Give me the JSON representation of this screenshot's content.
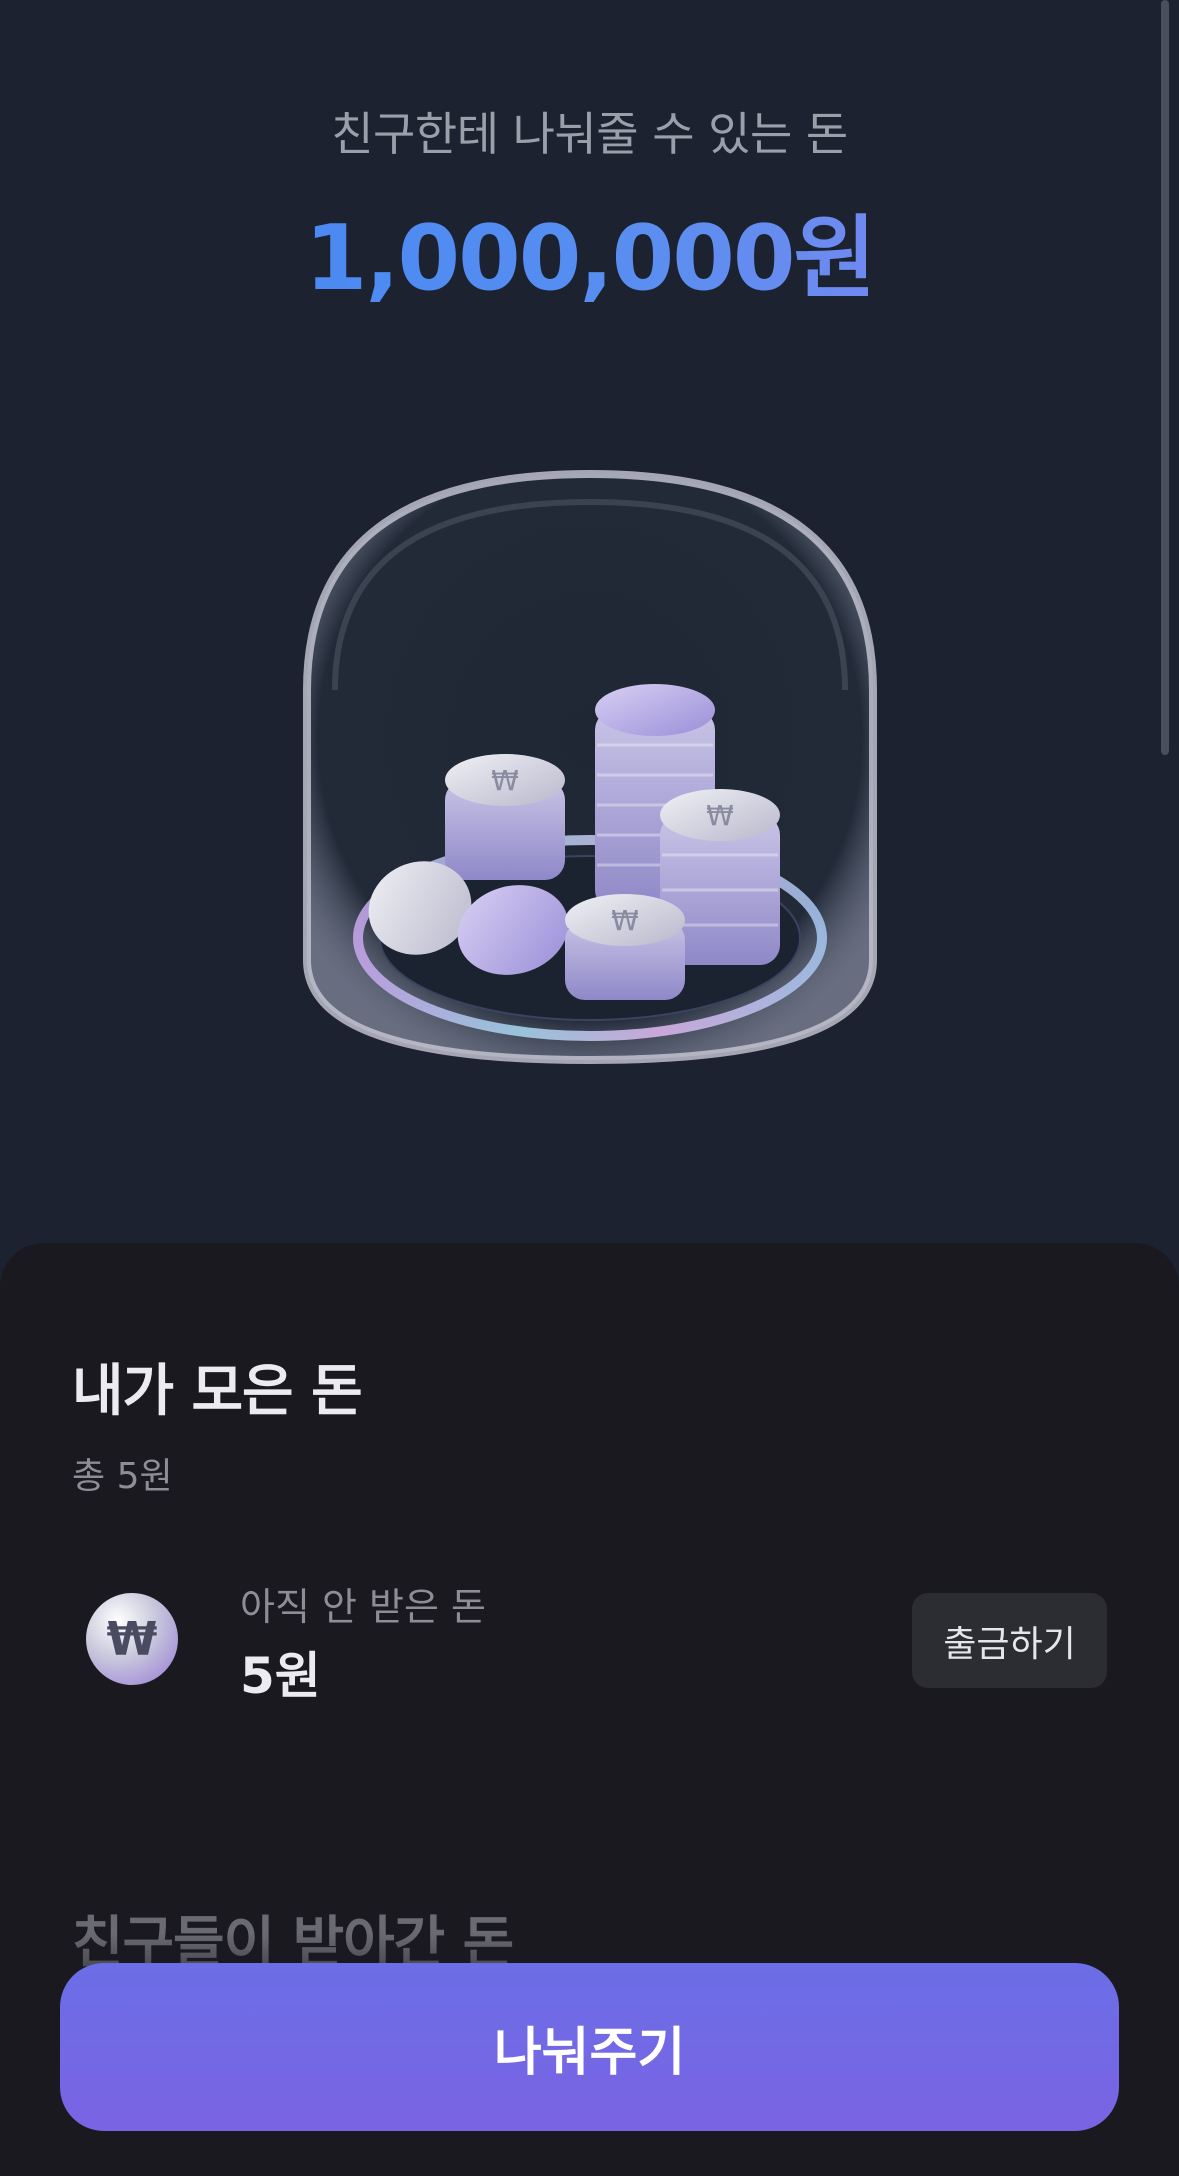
{
  "header": {
    "subtitle": "친구한테 나눠줄 수 있는 돈",
    "amount": "1,000,000원"
  },
  "illustration": {
    "icon": "coin-dome-illustration",
    "coin_symbol": "₩"
  },
  "sheet": {
    "title": "내가 모은 돈",
    "total": "총 5원",
    "pending": {
      "label": "아직 안 받은 돈",
      "amount": "5원",
      "icon": "won-coin-icon",
      "coin_symbol": "₩"
    },
    "withdraw_label": "출금하기",
    "friends_heading": "친구들이 받아간 돈"
  },
  "cta": {
    "share_label": "나눠주기"
  },
  "colors": {
    "background": "#1c2230",
    "sheet": "#1a191f",
    "accent_blue": "#3d86f5",
    "accent_purple": "#7a63e4"
  }
}
